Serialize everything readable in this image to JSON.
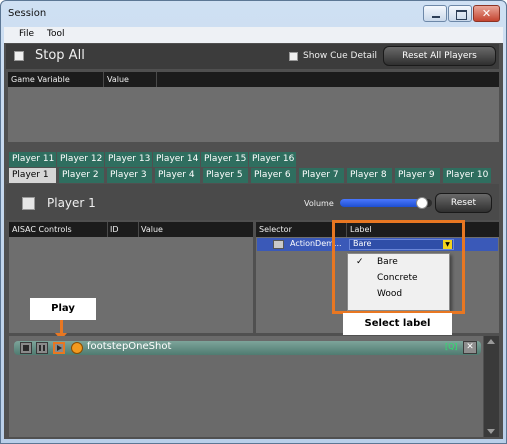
{
  "window": {
    "title": "Session"
  },
  "menu": [
    "File",
    "Tool"
  ],
  "top_bar": {
    "stop_all_label": "Stop All",
    "show_cue_detail_label": "Show Cue Detail",
    "reset_all_players_label": "Reset All Players"
  },
  "game_variable_table": {
    "columns": [
      "Game Variable",
      "Value"
    ]
  },
  "player_tabs": {
    "row1": [
      "Player 11",
      "Player 12",
      "Player 13",
      "Player 14",
      "Player 15",
      "Player 16"
    ],
    "row2": [
      "Player 1",
      "Player 2",
      "Player 3",
      "Player 4",
      "Player 5",
      "Player 6",
      "Player 7",
      "Player 8",
      "Player 9",
      "Player 10"
    ],
    "active": "Player 1"
  },
  "player_panel": {
    "name": "Player 1",
    "volume_label": "Volume",
    "volume_level": 0.95,
    "reset_label": "Reset"
  },
  "aisac_table": {
    "columns": [
      "AISAC Controls",
      "ID",
      "Value"
    ]
  },
  "selector_table": {
    "columns": [
      "Selector",
      "Label"
    ],
    "row": {
      "selector": "ActionDem...",
      "label": "Bare"
    }
  },
  "label_dropdown": {
    "options": [
      "Bare",
      "Concrete",
      "Wood"
    ],
    "selected": "Bare",
    "check_mark": "✓"
  },
  "annotations": {
    "play": "Play",
    "select_label": "Select label"
  },
  "cue": {
    "name": "footstepOneShot",
    "tag": "[Q]"
  },
  "colors": {
    "accent_orange": "#e87722",
    "tab_teal": "#2f6e5f",
    "selected_row_blue": "#3a59b8",
    "dark_panel": "#505050"
  }
}
